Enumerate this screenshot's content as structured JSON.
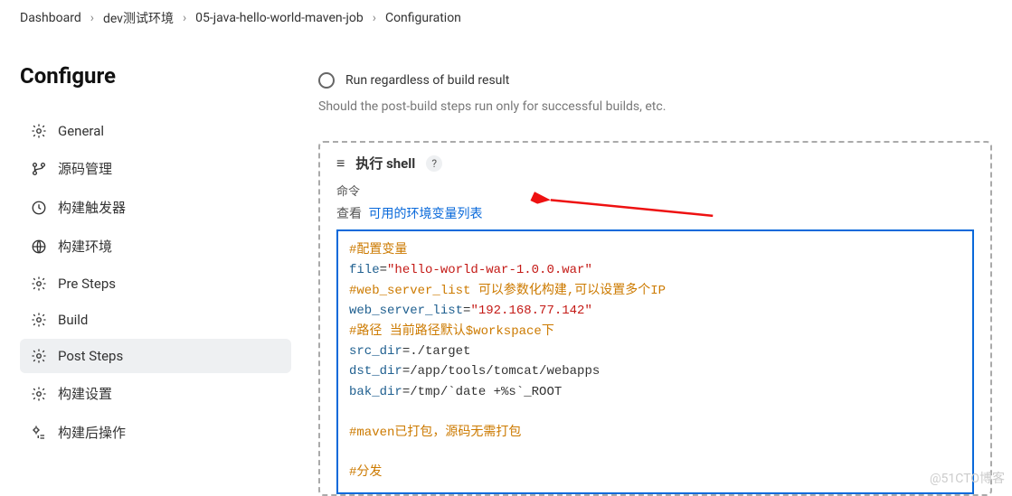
{
  "breadcrumb": [
    "Dashboard",
    "dev测试环境",
    "05-java-hello-world-maven-job",
    "Configuration"
  ],
  "page_title": "Configure",
  "sidebar": {
    "items": [
      {
        "label": "General",
        "icon": "gear"
      },
      {
        "label": "源码管理",
        "icon": "branch"
      },
      {
        "label": "构建触发器",
        "icon": "clock"
      },
      {
        "label": "构建环境",
        "icon": "globe"
      },
      {
        "label": "Pre Steps",
        "icon": "gear"
      },
      {
        "label": "Build",
        "icon": "gear"
      },
      {
        "label": "Post Steps",
        "icon": "gear",
        "active": true
      },
      {
        "label": "构建设置",
        "icon": "gear"
      },
      {
        "label": "构建后操作",
        "icon": "gear-tree"
      }
    ]
  },
  "main": {
    "radio_label": "Run regardless of build result",
    "hint_text": "Should the post-build steps run only for successful builds, etc.",
    "shell_title": "执行 shell",
    "help_mark": "?",
    "cmd_label": "命令",
    "env_prefix": "查看",
    "env_link": "可用的环境变量列表",
    "code_lines": [
      {
        "t": "comment",
        "s": "#配置变量"
      },
      {
        "t": "assign",
        "k": "file",
        "v": "\"hello-world-war-1.0.0.war\""
      },
      {
        "t": "comment",
        "s": "#web_server_list 可以参数化构建,可以设置多个IP"
      },
      {
        "t": "assign",
        "k": "web_server_list",
        "v": "\"192.168.77.142\""
      },
      {
        "t": "comment",
        "s": "#路径 当前路径默认$workspace下"
      },
      {
        "t": "assign_plain",
        "k": "src_dir",
        "v": "./target"
      },
      {
        "t": "assign_plain",
        "k": "dst_dir",
        "v": "/app/tools/tomcat/webapps"
      },
      {
        "t": "assign_plain",
        "k": "bak_dir",
        "v": "/tmp/`date +%s`_ROOT"
      },
      {
        "t": "blank",
        "s": ""
      },
      {
        "t": "comment",
        "s": "#maven已打包，源码无需打包"
      },
      {
        "t": "blank",
        "s": ""
      },
      {
        "t": "comment",
        "s": "#分发"
      }
    ]
  },
  "watermark": "@51CTO博客"
}
